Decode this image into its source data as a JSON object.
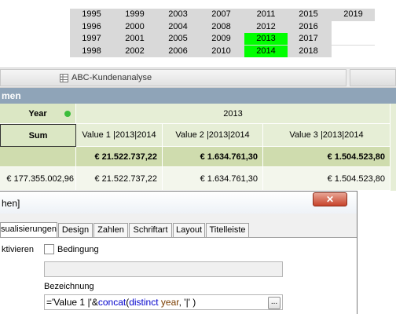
{
  "year_list": {
    "columns": [
      [
        {
          "y": "1995",
          "s": "n"
        },
        {
          "y": "1996",
          "s": "n"
        },
        {
          "y": "1997",
          "s": "n"
        },
        {
          "y": "1998",
          "s": "n"
        }
      ],
      [
        {
          "y": "1999",
          "s": "n"
        },
        {
          "y": "2000",
          "s": "n"
        },
        {
          "y": "2001",
          "s": "n"
        },
        {
          "y": "2002",
          "s": "n"
        }
      ],
      [
        {
          "y": "2003",
          "s": "n"
        },
        {
          "y": "2004",
          "s": "n"
        },
        {
          "y": "2005",
          "s": "n"
        },
        {
          "y": "2006",
          "s": "n"
        }
      ],
      [
        {
          "y": "2007",
          "s": "n"
        },
        {
          "y": "2008",
          "s": "n"
        },
        {
          "y": "2009",
          "s": "n"
        },
        {
          "y": "2010",
          "s": "n"
        }
      ],
      [
        {
          "y": "2011",
          "s": "n"
        },
        {
          "y": "2012",
          "s": "n"
        },
        {
          "y": "2013",
          "s": "sel"
        },
        {
          "y": "2014",
          "s": "sel"
        }
      ],
      [
        {
          "y": "2015",
          "s": "n"
        },
        {
          "y": "2016",
          "s": "n"
        },
        {
          "y": "2017",
          "s": "n"
        },
        {
          "y": "2018",
          "s": "n"
        }
      ],
      [
        {
          "y": "2019",
          "s": "n"
        },
        {
          "y": "",
          "s": "w"
        },
        {
          "y": "",
          "s": "w"
        },
        {
          "y": "",
          "s": "w"
        }
      ]
    ],
    "selected_color": "#00ff00"
  },
  "tabs": {
    "active_label": "ABC-Kundenanalyse",
    "active_icon": "table-icon"
  },
  "caption": {
    "text": "men"
  },
  "pivot": {
    "dim_label": "Year",
    "dim_value": "2013",
    "sum_label": "Sum",
    "columns": [
      "Value 1 |2013|2014",
      "Value 2 |2013|2014",
      "Value 3 |2013|2014"
    ],
    "totals": [
      "€ 21.522.737,22",
      "€ 1.634.761,30",
      "€ 1.504.523,80"
    ],
    "row": {
      "sum": "€ 177.355.002,96",
      "values": [
        "€ 21.522.737,22",
        "€ 1.634.761,30",
        "€ 1.504.523,80"
      ]
    },
    "colors": {
      "header": "#dbe7c4",
      "total": "#cfdcae",
      "data": "#f3f6ec"
    }
  },
  "dialog": {
    "title": "hen]",
    "close_glyph": "✕",
    "tabs": [
      "sualisierungen",
      "Design",
      "Zahlen",
      "Schriftart",
      "Layout",
      "Titelleiste"
    ],
    "activate_label": "ktivieren",
    "condition_label": "Bedingung",
    "label_heading": "Bezeichnung",
    "expression": {
      "p1": "='Value 1 |'&",
      "p2": "concat",
      "p3": "(",
      "p4": "distinct",
      "p5": " ",
      "p6": "year",
      "p7": ", '|' )"
    },
    "browse_button": "..."
  }
}
